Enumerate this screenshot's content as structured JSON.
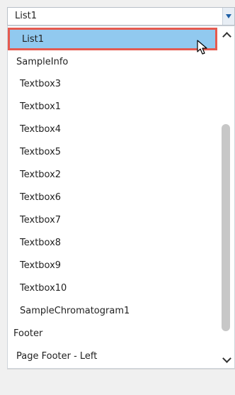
{
  "combo": {
    "selected_value": "List1"
  },
  "list": {
    "items": [
      {
        "label": "List1",
        "indent": 2,
        "selected": true
      },
      {
        "label": "SampleInfo",
        "indent": 1
      },
      {
        "label": "Textbox3",
        "indent": 2
      },
      {
        "label": "Textbox1",
        "indent": 2
      },
      {
        "label": "Textbox4",
        "indent": 2
      },
      {
        "label": "Textbox5",
        "indent": 2
      },
      {
        "label": "Textbox2",
        "indent": 2
      },
      {
        "label": "Textbox6",
        "indent": 2
      },
      {
        "label": "Textbox7",
        "indent": 2
      },
      {
        "label": "Textbox8",
        "indent": 2
      },
      {
        "label": "Textbox9",
        "indent": 2
      },
      {
        "label": "Textbox10",
        "indent": 2
      },
      {
        "label": "SampleChromatogram1",
        "indent": 2
      },
      {
        "label": "Footer",
        "indent": 0
      },
      {
        "label": "Page Footer - Left",
        "indent": 1
      }
    ]
  },
  "icons": {
    "dropdown": "triangle-down-icon",
    "scroll_up": "chevron-up-icon",
    "scroll_down": "chevron-down-icon",
    "cursor": "mouse-pointer-icon"
  },
  "colors": {
    "selection": "#91c9ef",
    "highlight_border": "#e65a4f",
    "dropdown_arrow": "#1e5fa6"
  }
}
